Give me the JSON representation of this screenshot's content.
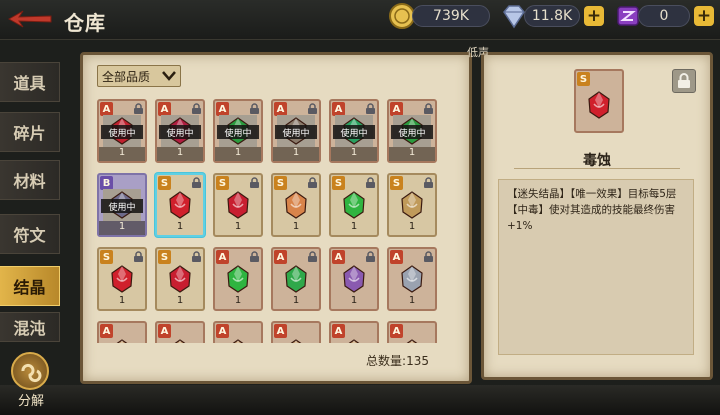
{
  "header": {
    "title": "仓库",
    "gold": "739K",
    "diamonds": "11.8K",
    "tickets": "0"
  },
  "sidebar": {
    "items": [
      {
        "label": "道具",
        "active": false
      },
      {
        "label": "碎片",
        "active": false
      },
      {
        "label": "材料",
        "active": false
      },
      {
        "label": "符文",
        "active": false
      },
      {
        "label": "结晶",
        "active": true
      },
      {
        "label": "混沌",
        "active": false
      }
    ],
    "decompose_label": "分解"
  },
  "main": {
    "filter_label": "全部品质",
    "total_label": "总数量:135",
    "in_use_label": "使用中",
    "cards": [
      {
        "rarity": "A",
        "color": "#c0202e",
        "qty": "1",
        "inuse": true,
        "lock": true,
        "selected": false
      },
      {
        "rarity": "A",
        "color": "#b01c40",
        "qty": "1",
        "inuse": true,
        "lock": true,
        "selected": false
      },
      {
        "rarity": "A",
        "color": "#2a9a3e",
        "qty": "1",
        "inuse": true,
        "lock": true,
        "selected": false
      },
      {
        "rarity": "A",
        "color": "#8a7a6a",
        "qty": "1",
        "inuse": true,
        "lock": true,
        "selected": false
      },
      {
        "rarity": "A",
        "color": "#28a060",
        "qty": "1",
        "inuse": true,
        "lock": true,
        "selected": false
      },
      {
        "rarity": "A",
        "color": "#2a9a3e",
        "qty": "1",
        "inuse": true,
        "lock": true,
        "selected": false
      },
      {
        "rarity": "B",
        "color": "#6d6a8a",
        "qty": "1",
        "inuse": true,
        "lock": false,
        "selected": false
      },
      {
        "rarity": "S",
        "color": "#d0202c",
        "qty": "1",
        "inuse": false,
        "lock": true,
        "selected": true
      },
      {
        "rarity": "S",
        "color": "#c81e30",
        "qty": "1",
        "inuse": false,
        "lock": true,
        "selected": false
      },
      {
        "rarity": "S",
        "color": "#d8844a",
        "qty": "1",
        "inuse": false,
        "lock": true,
        "selected": false
      },
      {
        "rarity": "S",
        "color": "#2fb440",
        "qty": "1",
        "inuse": false,
        "lock": true,
        "selected": false
      },
      {
        "rarity": "S",
        "color": "#c09a5a",
        "qty": "1",
        "inuse": false,
        "lock": true,
        "selected": false
      },
      {
        "rarity": "S",
        "color": "#d0202c",
        "qty": "1",
        "inuse": false,
        "lock": true,
        "selected": false
      },
      {
        "rarity": "S",
        "color": "#c81e30",
        "qty": "1",
        "inuse": false,
        "lock": true,
        "selected": false
      },
      {
        "rarity": "A",
        "color": "#2fb440",
        "qty": "1",
        "inuse": false,
        "lock": true,
        "selected": false
      },
      {
        "rarity": "A",
        "color": "#2fa84a",
        "qty": "1",
        "inuse": false,
        "lock": true,
        "selected": false
      },
      {
        "rarity": "A",
        "color": "#8a5ab0",
        "qty": "1",
        "inuse": false,
        "lock": true,
        "selected": false
      },
      {
        "rarity": "A",
        "color": "#9aa2b0",
        "qty": "1",
        "inuse": false,
        "lock": true,
        "selected": false
      },
      {
        "rarity": "A",
        "color": "#c8a070",
        "qty": "",
        "inuse": false,
        "lock": false,
        "selected": false
      },
      {
        "rarity": "A",
        "color": "#c8a070",
        "qty": "",
        "inuse": false,
        "lock": false,
        "selected": false
      },
      {
        "rarity": "A",
        "color": "#c8a070",
        "qty": "",
        "inuse": false,
        "lock": false,
        "selected": false
      },
      {
        "rarity": "A",
        "color": "#c8a070",
        "qty": "",
        "inuse": false,
        "lock": false,
        "selected": false
      },
      {
        "rarity": "A",
        "color": "#c8a070",
        "qty": "",
        "inuse": false,
        "lock": false,
        "selected": false
      },
      {
        "rarity": "A",
        "color": "#c8a070",
        "qty": "",
        "inuse": false,
        "lock": false,
        "selected": false
      }
    ]
  },
  "detail": {
    "overlay_label": "低声",
    "name": "毒蚀",
    "badge": "S",
    "color": "#d0202c",
    "description": "【迷失结晶】【唯一效果】目标每5层【中毒】使对其造成的技能最终伤害+1%"
  },
  "colors": {
    "accent_gold": "#e2b54a",
    "selected_border": "#5fd0e4",
    "rarity_S": "#c9821e",
    "rarity_A": "#c0432b",
    "rarity_B": "#6a4ea8"
  }
}
